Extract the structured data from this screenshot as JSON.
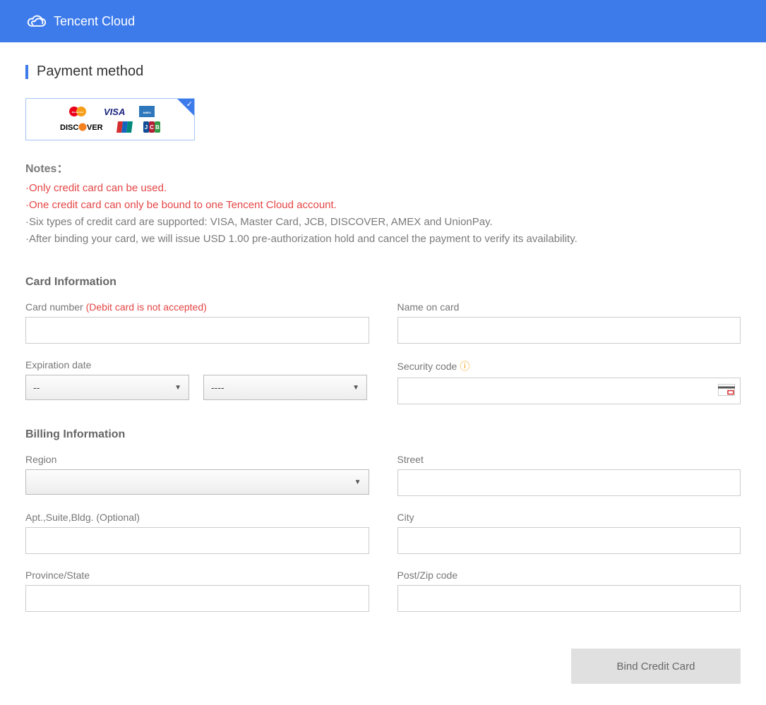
{
  "header": {
    "brand": "Tencent Cloud"
  },
  "page": {
    "title": "Payment method"
  },
  "notes": {
    "title": "Notes：",
    "red1": "·Only credit card can be used.",
    "red2": "·One credit card can only be bound to one Tencent Cloud account.",
    "gray1": "·Six types of credit card are supported: VISA, Master Card, JCB, DISCOVER, AMEX and UnionPay.",
    "gray2": "·After binding your card, we will issue USD 1.00 pre-authorization hold and cancel the payment to verify its availability."
  },
  "card": {
    "section": "Card Information",
    "number_label": "Card number ",
    "number_warn": "(Debit card is not accepted)",
    "name_label": "Name on card",
    "exp_label": "Expiration date",
    "exp_month": "--",
    "exp_year": "----",
    "sec_label": "Security code"
  },
  "billing": {
    "section": "Billing Information",
    "region_label": "Region",
    "region_value": "",
    "street_label": "Street",
    "apt_label": "Apt.,Suite,Bldg. (Optional)",
    "city_label": "City",
    "province_label": "Province/State",
    "zip_label": "Post/Zip code"
  },
  "submit": {
    "label": "Bind Credit Card"
  }
}
